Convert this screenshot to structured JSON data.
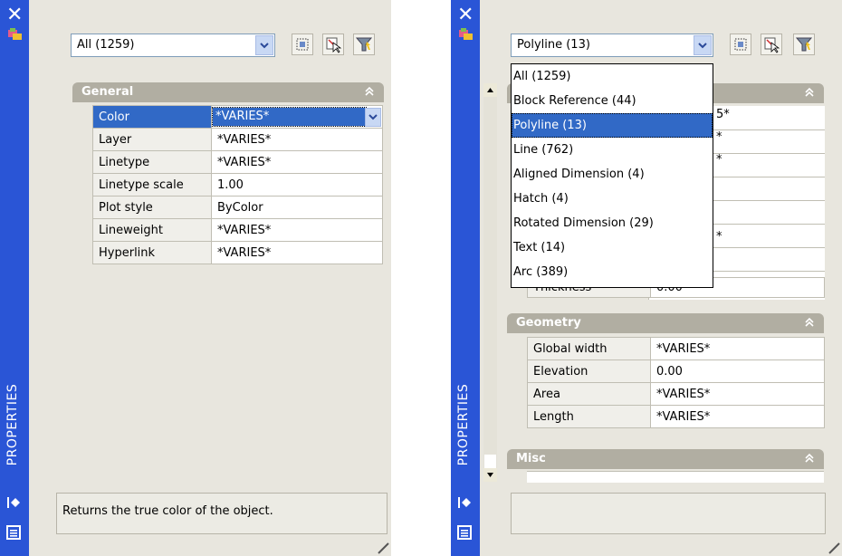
{
  "left": {
    "title": "PROPERTIES",
    "filter_value": "All (1259)",
    "section_general": {
      "title": "General",
      "rows": [
        {
          "label": "Color",
          "value": "*VARIES*"
        },
        {
          "label": "Layer",
          "value": "*VARIES*"
        },
        {
          "label": "Linetype",
          "value": "*VARIES*"
        },
        {
          "label": "Linetype scale",
          "value": "1.00"
        },
        {
          "label": "Plot style",
          "value": "ByColor"
        },
        {
          "label": "Lineweight",
          "value": "*VARIES*"
        },
        {
          "label": "Hyperlink",
          "value": "*VARIES*"
        }
      ]
    },
    "description": "Returns the true color of the object."
  },
  "right": {
    "title": "PROPERTIES",
    "filter_value": "Polyline (13)",
    "dropdown_options": [
      "All (1259)",
      "Block Reference (44)",
      "Polyline (13)",
      "Line (762)",
      "Aligned Dimension (4)",
      "Hatch (4)",
      "Rotated Dimension (29)",
      "Text (14)",
      "Arc (389)"
    ],
    "selected_index": 2,
    "partial_values": [
      "5*",
      "*",
      "*",
      "*"
    ],
    "thickness": {
      "label": "Thickness",
      "value": "0.00"
    },
    "section_geometry": {
      "title": "Geometry",
      "rows": [
        {
          "label": "Global width",
          "value": "*VARIES*"
        },
        {
          "label": "Elevation",
          "value": "0.00"
        },
        {
          "label": "Area",
          "value": "*VARIES*"
        },
        {
          "label": "Length",
          "value": "*VARIES*"
        }
      ]
    },
    "section_misc": {
      "title": "Misc"
    }
  },
  "colors": {
    "strip": "#2a55d6",
    "selection": "#3169c6",
    "section_header": "#b1aea2",
    "panel": "#e8e6de"
  }
}
